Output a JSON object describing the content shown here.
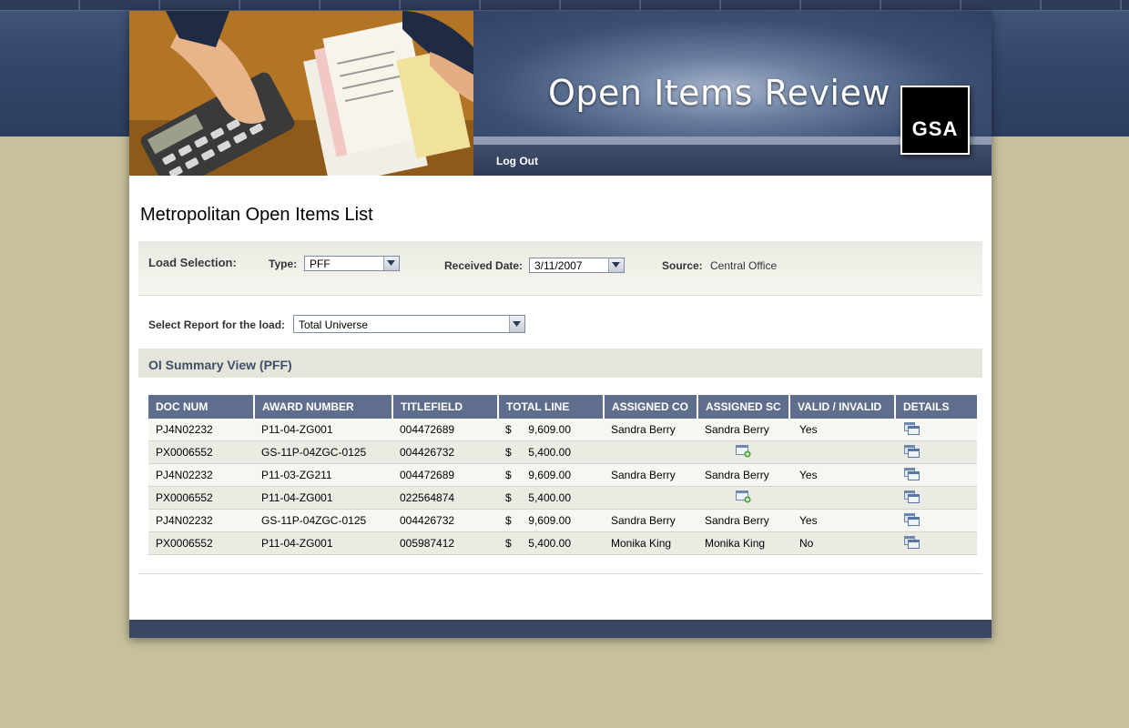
{
  "header": {
    "title": "Open Items Review",
    "logo_text": "GSA",
    "nav": {
      "logout_label": "Log Out"
    }
  },
  "page": {
    "title": "Metropolitan Open Items List"
  },
  "load_selection": {
    "label": "Load Selection:",
    "type_label": "Type:",
    "type_value": "PFF",
    "received_date_label": "Received Date:",
    "received_date_value": "3/11/2007",
    "source_label": "Source:",
    "source_value": "Central Office"
  },
  "report": {
    "label": "Select Report for the load:",
    "value": "Total Universe"
  },
  "summary": {
    "title": "OI Summary View (PFF)",
    "columns": [
      "DOC NUM",
      "AWARD NUMBER",
      "TITLEFIELD",
      "TOTAL LINE",
      "ASSIGNED CO",
      "ASSIGNED SC",
      "VALID / INVALID",
      "DETAILS"
    ],
    "currency_symbol": "$",
    "rows": [
      {
        "doc_num": "PJ4N02232",
        "award_number": "P11-04-ZG001",
        "titlefield": "004472689",
        "total_line": "9,609.00",
        "assigned_co": "Sandra Berry",
        "assigned_sc": "Sandra Berry",
        "valid": "Yes",
        "sc_icon": false
      },
      {
        "doc_num": "PX0006552",
        "award_number": "GS-11P-04ZGC-0125",
        "titlefield": "004426732",
        "total_line": "5,400.00",
        "assigned_co": "",
        "assigned_sc": "",
        "valid": "",
        "sc_icon": true
      },
      {
        "doc_num": "PJ4N02232",
        "award_number": "P11-03-ZG211",
        "titlefield": "004472689",
        "total_line": "9,609.00",
        "assigned_co": "Sandra Berry",
        "assigned_sc": "Sandra Berry",
        "valid": "Yes",
        "sc_icon": false
      },
      {
        "doc_num": "PX0006552",
        "award_number": "P11-04-ZG001",
        "titlefield": "022564874",
        "total_line": "5,400.00",
        "assigned_co": "",
        "assigned_sc": "",
        "valid": "",
        "sc_icon": true
      },
      {
        "doc_num": "PJ4N02232",
        "award_number": "GS-11P-04ZGC-0125",
        "titlefield": "004426732",
        "total_line": "9,609.00",
        "assigned_co": "Sandra Berry",
        "assigned_sc": "Sandra Berry",
        "valid": "Yes",
        "sc_icon": false
      },
      {
        "doc_num": "PX0006552",
        "award_number": "P11-04-ZG001",
        "titlefield": "005987412",
        "total_line": "5,400.00",
        "assigned_co": "Monika King",
        "assigned_sc": "Monika King",
        "valid": "No",
        "sc_icon": false
      }
    ]
  },
  "icons": {
    "details": "details-windows-icon",
    "assign": "assign-add-icon",
    "dropdown": "chevron-down-icon"
  },
  "colors": {
    "header_band": "#34476a",
    "table_header": "#5f6e8d",
    "background": "#c7c09d",
    "footer": "#3a4762"
  }
}
